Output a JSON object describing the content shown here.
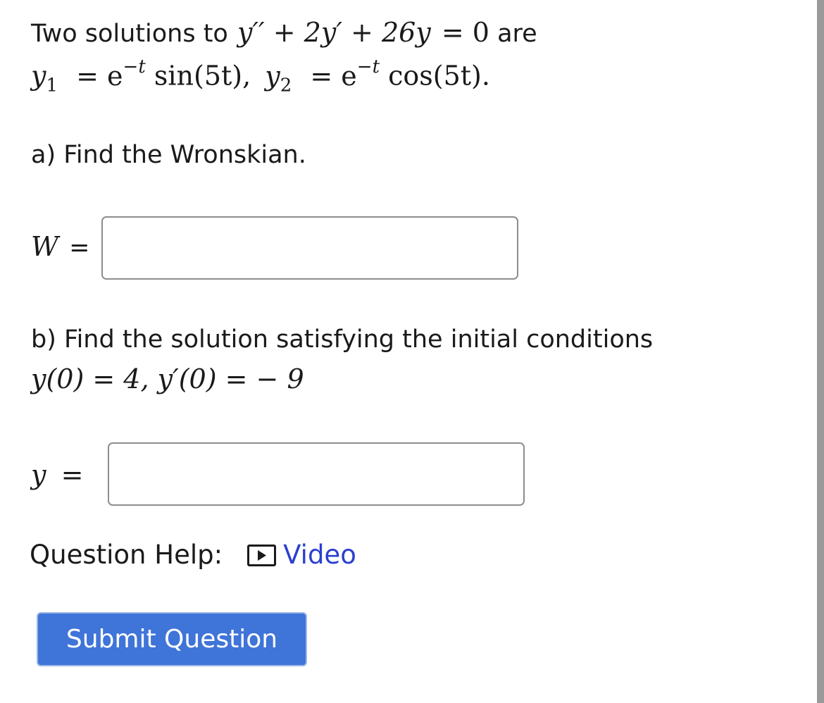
{
  "problem": {
    "intro_text": "Two solutions to",
    "equation_lhs": "y′′ + 2y′ + 26y",
    "equation_rhs": "= 0",
    "are_text": "are",
    "y1_label": "y",
    "y1_sub": "1",
    "y1_expr": "= e",
    "y1_exp": "−t",
    "y1_tail": "sin(5t),",
    "y2_label": "y",
    "y2_sub": "2",
    "y2_expr": "= e",
    "y2_exp": "−t",
    "y2_tail": "cos(5t)."
  },
  "part_a": {
    "prompt": "a) Find the Wronskian.",
    "var_label": "W",
    "equals": "=",
    "answer_value": ""
  },
  "part_b": {
    "prompt": "b) Find the solution satisfying the initial conditions",
    "conditions": "y(0) = 4,  y′(0) = − 9",
    "var_label": "y",
    "equals": "=",
    "answer_value": ""
  },
  "help": {
    "label": "Question Help:",
    "video_icon": "play-icon",
    "video_link": "Video",
    "link_color": "#2b3fd0"
  },
  "submit": {
    "label": "Submit Question",
    "color": "#3f74d8"
  }
}
